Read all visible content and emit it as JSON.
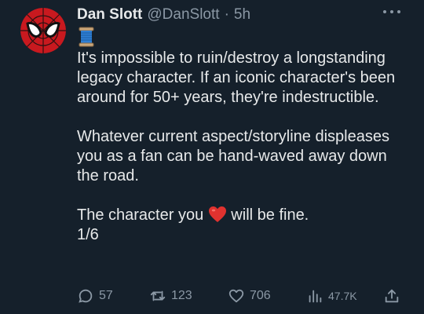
{
  "tweet": {
    "author_name": "Dan Slott",
    "handle": "@DanSlott",
    "separator": "·",
    "time": "5h",
    "paragraphs": [
      "It's impossible to ruin/destroy a longstanding legacy character. If an iconic character's been around for 50+ years, they're indestructible.",
      "Whatever current aspect/storyline displeases you as a fan can be hand-waved away down the road."
    ],
    "last_line_before": "The character you ",
    "last_line_after": " will be fine.",
    "thread_count": "1/6"
  },
  "actions": {
    "replies": "57",
    "retweets": "123",
    "likes": "706",
    "views": "47.7K"
  },
  "icons": {
    "avatar": "spider-man-avatar",
    "thread": "spool-of-thread-emoji",
    "heart": "red-heart-emoji",
    "more": "more-options-icon",
    "reply": "reply-icon",
    "retweet": "retweet-icon",
    "like": "like-icon",
    "views": "views-icon",
    "share": "share-icon"
  },
  "colors": {
    "background": "#15202b",
    "text": "#e7e9ea",
    "muted": "#8b98a5",
    "heart": "#e0322f"
  }
}
